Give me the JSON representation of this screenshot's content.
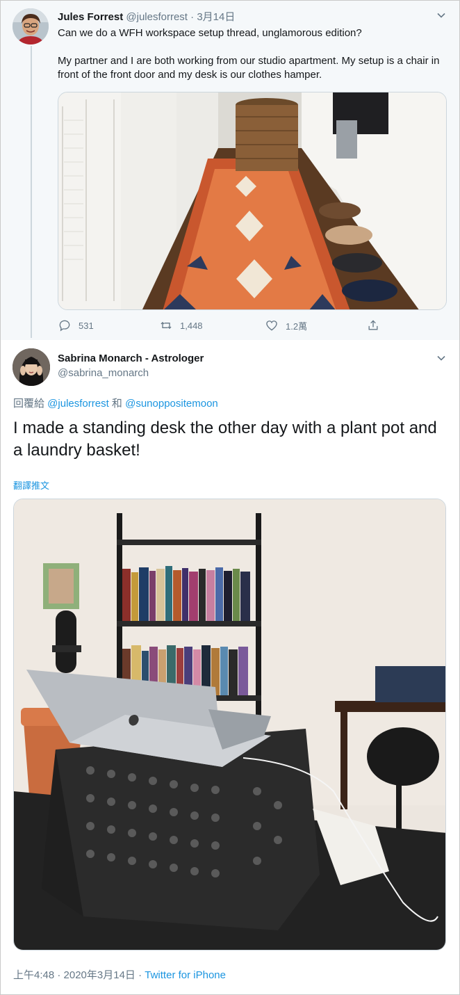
{
  "parent_tweet": {
    "name": "Jules Forrest",
    "handle": "@julesforrest",
    "separator": " · ",
    "date": "3月14日",
    "text_1": "Can we do a WFH workspace setup thread, unglamorous edition?",
    "text_2": "My partner and I are both working from our studio apartment. My setup is a chair in front of the front door and my desk is our clothes hamper.",
    "replies": "531",
    "retweets": "1,448",
    "likes": "1.2萬"
  },
  "main_tweet": {
    "name": "Sabrina Monarch - Astrologer",
    "handle": "@sabrina_monarch",
    "reply_prefix": "回覆給 ",
    "reply_to_1": "@julesforrest",
    "reply_joiner": " 和 ",
    "reply_to_2": "@sunoppositemoon",
    "text": "I made a standing desk the other day with a plant pot and a laundry basket!",
    "translate": "翻譯推文",
    "timestamp": "上午4:48 · 2020年3月14日",
    "meta_separator": " · ",
    "source": "Twitter for iPhone"
  },
  "colors": {
    "link": "#1b95e0",
    "muted": "#657786",
    "parent_bg": "#f5f8fa"
  },
  "icons": [
    "chevron-down-icon",
    "reply-icon",
    "retweet-icon",
    "like-icon",
    "share-icon"
  ]
}
